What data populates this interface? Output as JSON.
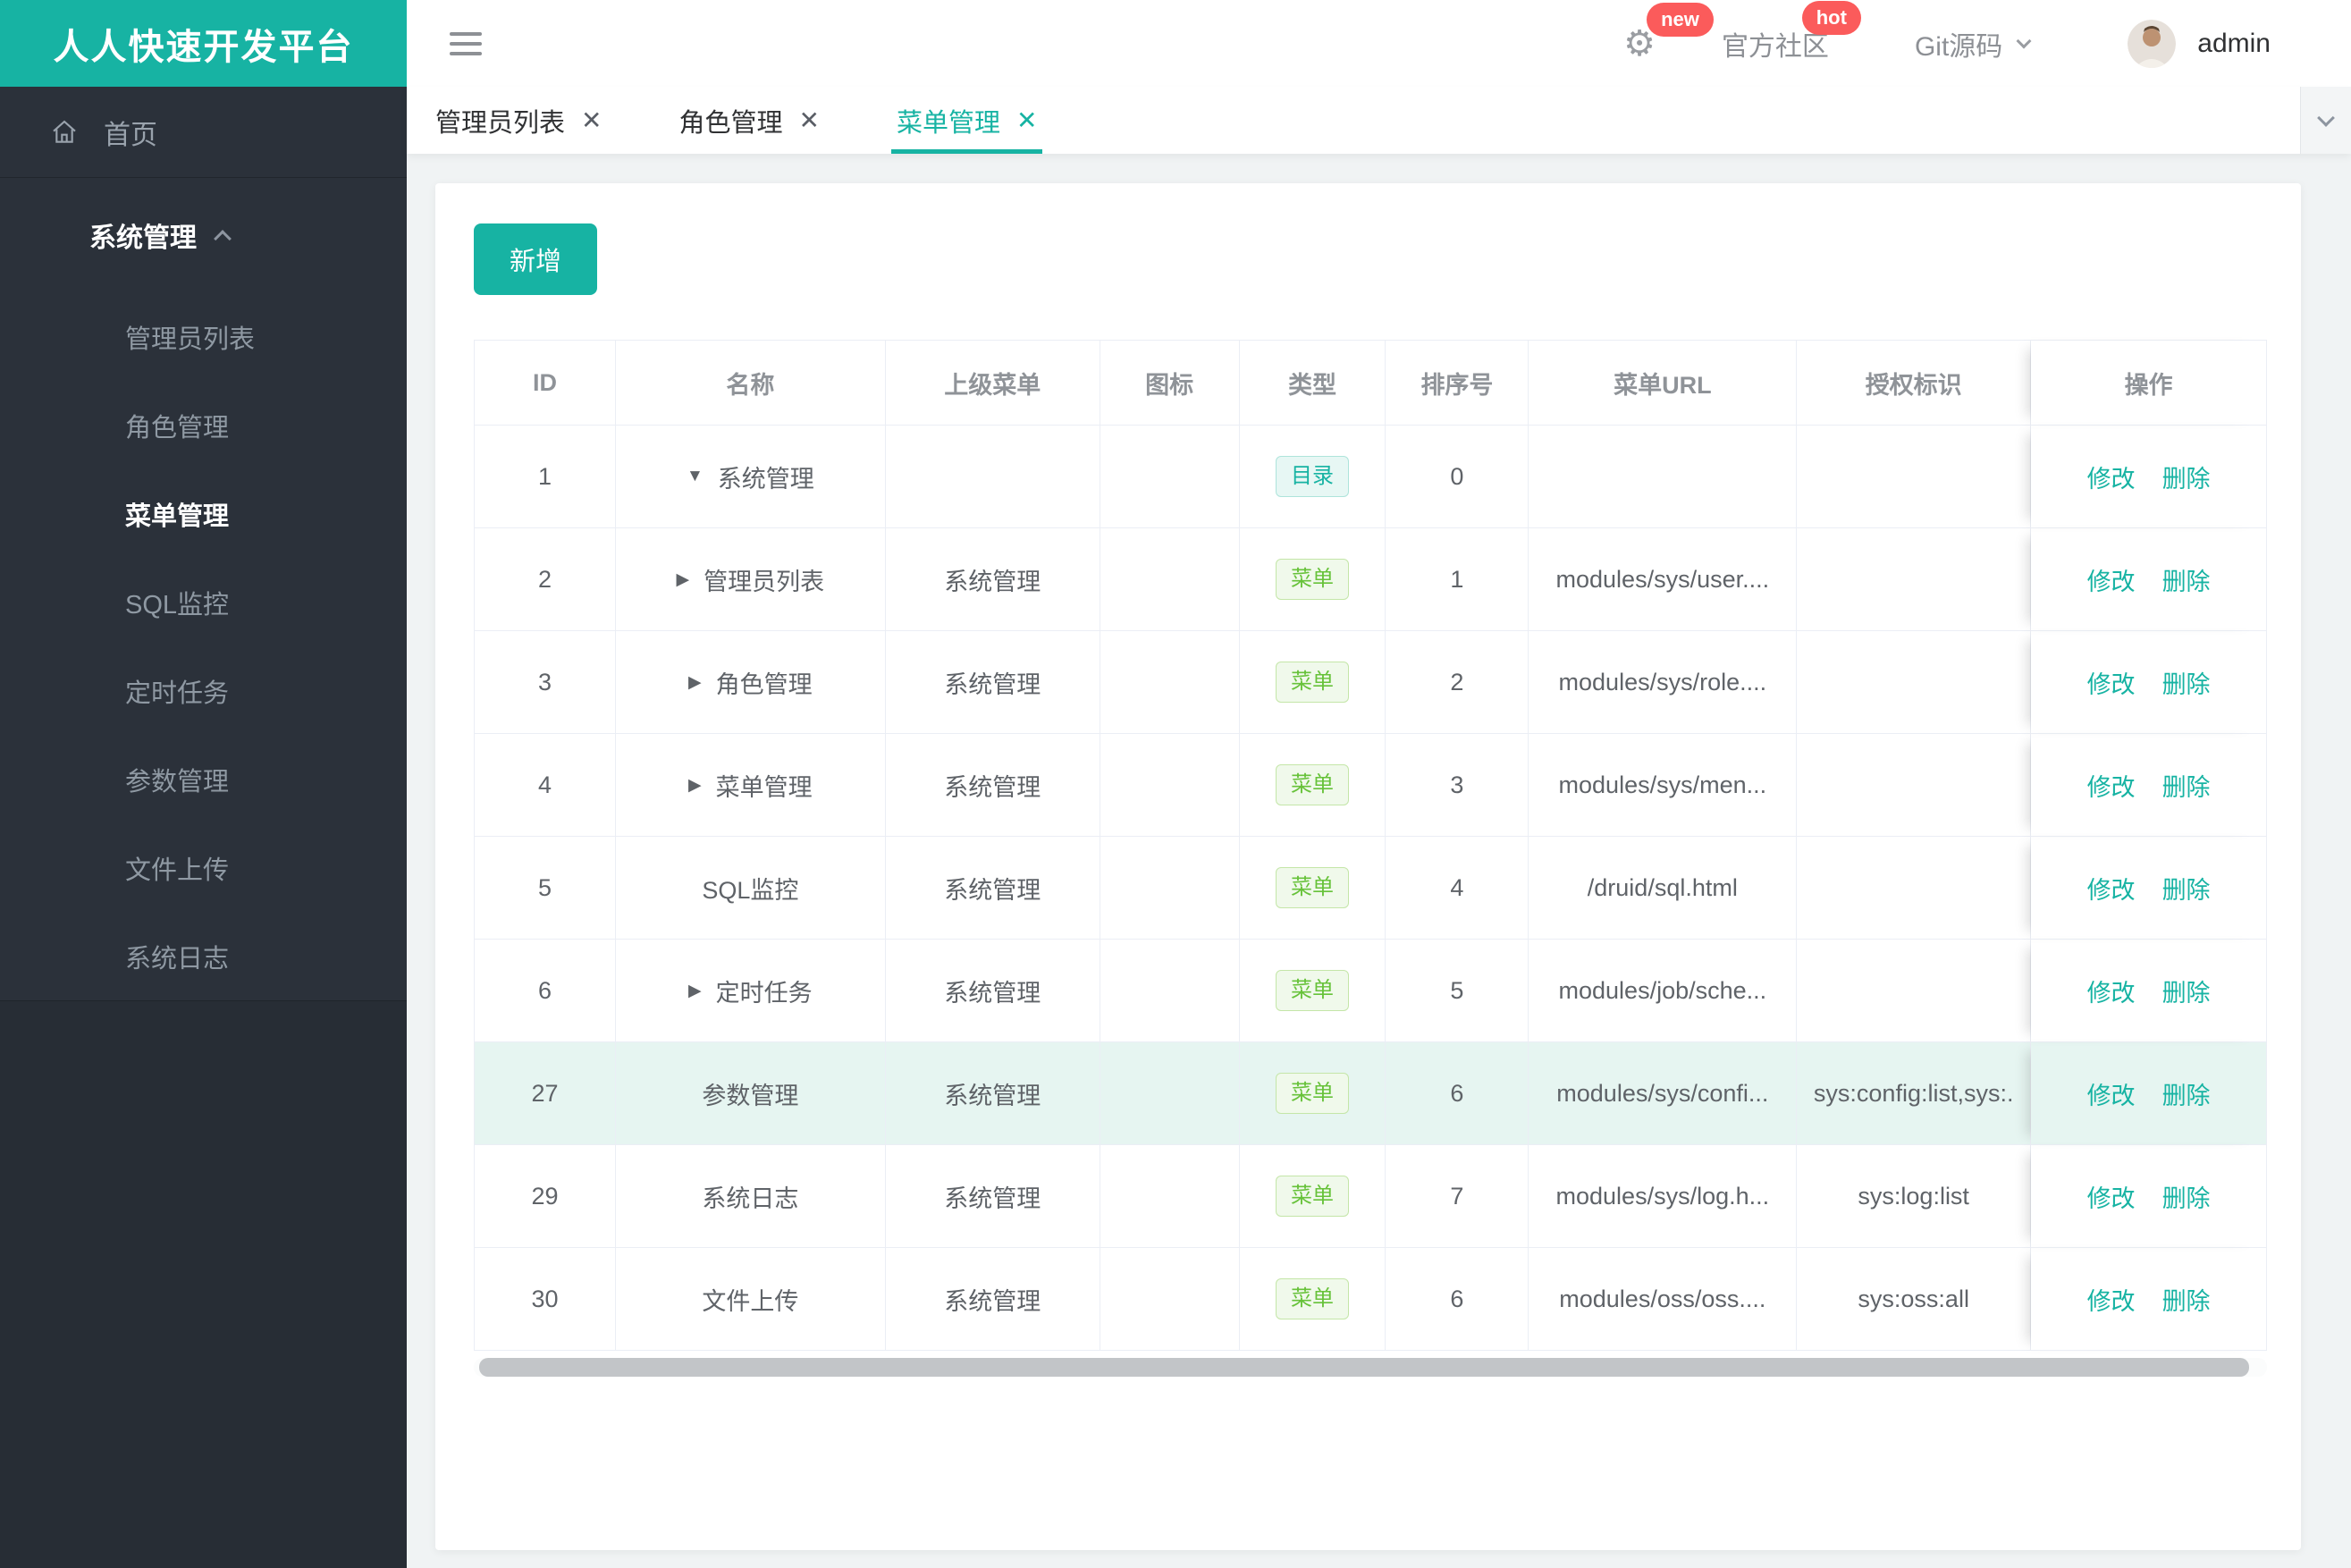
{
  "app": {
    "title": "人人快速开发平台"
  },
  "topbar": {
    "badge_new": "new",
    "community_label": "官方社区",
    "badge_hot": "hot",
    "git_label": "Git源码",
    "username": "admin"
  },
  "sidebar": {
    "home_label": "首页",
    "group_label": "系统管理",
    "items": [
      {
        "label": "管理员列表",
        "active": false
      },
      {
        "label": "角色管理",
        "active": false
      },
      {
        "label": "菜单管理",
        "active": true
      },
      {
        "label": "SQL监控",
        "active": false
      },
      {
        "label": "定时任务",
        "active": false
      },
      {
        "label": "参数管理",
        "active": false
      },
      {
        "label": "文件上传",
        "active": false
      },
      {
        "label": "系统日志",
        "active": false
      }
    ]
  },
  "tabs": [
    {
      "label": "管理员列表",
      "active": false
    },
    {
      "label": "角色管理",
      "active": false
    },
    {
      "label": "菜单管理",
      "active": true
    }
  ],
  "toolbar": {
    "add_label": "新增"
  },
  "table": {
    "columns": [
      "ID",
      "名称",
      "上级菜单",
      "图标",
      "类型",
      "排序号",
      "菜单URL",
      "授权标识",
      "操作"
    ],
    "edit_label": "修改",
    "delete_label": "删除",
    "rows": [
      {
        "id": "1",
        "arrow": "down",
        "name": "系统管理",
        "parent": "",
        "type": "catalog",
        "type_label": "目录",
        "sort": "0",
        "url": "",
        "auth": "",
        "highlight": false
      },
      {
        "id": "2",
        "arrow": "right",
        "name": "管理员列表",
        "parent": "系统管理",
        "type": "menu",
        "type_label": "菜单",
        "sort": "1",
        "url": "modules/sys/user....",
        "auth": "",
        "highlight": false
      },
      {
        "id": "3",
        "arrow": "right",
        "name": "角色管理",
        "parent": "系统管理",
        "type": "menu",
        "type_label": "菜单",
        "sort": "2",
        "url": "modules/sys/role....",
        "auth": "",
        "highlight": false
      },
      {
        "id": "4",
        "arrow": "right",
        "name": "菜单管理",
        "parent": "系统管理",
        "type": "menu",
        "type_label": "菜单",
        "sort": "3",
        "url": "modules/sys/men...",
        "auth": "",
        "highlight": false
      },
      {
        "id": "5",
        "arrow": "",
        "name": "SQL监控",
        "parent": "系统管理",
        "type": "menu",
        "type_label": "菜单",
        "sort": "4",
        "url": "/druid/sql.html",
        "auth": "",
        "highlight": false
      },
      {
        "id": "6",
        "arrow": "right",
        "name": "定时任务",
        "parent": "系统管理",
        "type": "menu",
        "type_label": "菜单",
        "sort": "5",
        "url": "modules/job/sche...",
        "auth": "",
        "highlight": false
      },
      {
        "id": "27",
        "arrow": "",
        "name": "参数管理",
        "parent": "系统管理",
        "type": "menu",
        "type_label": "菜单",
        "sort": "6",
        "url": "modules/sys/confi...",
        "auth": "sys:config:list,sys:.",
        "highlight": true
      },
      {
        "id": "29",
        "arrow": "",
        "name": "系统日志",
        "parent": "系统管理",
        "type": "menu",
        "type_label": "菜单",
        "sort": "7",
        "url": "modules/sys/log.h...",
        "auth": "sys:log:list",
        "highlight": false
      },
      {
        "id": "30",
        "arrow": "",
        "name": "文件上传",
        "parent": "系统管理",
        "type": "menu",
        "type_label": "菜单",
        "sort": "6",
        "url": "modules/oss/oss....",
        "auth": "sys:oss:all",
        "highlight": false
      }
    ]
  },
  "colors": {
    "accent_teal": "#17b3a3",
    "badge_red": "#fb5b5b",
    "menu_green": "#67c23a",
    "sidebar_dark": "#2b313a",
    "row_highlight": "#e6f5f1"
  }
}
